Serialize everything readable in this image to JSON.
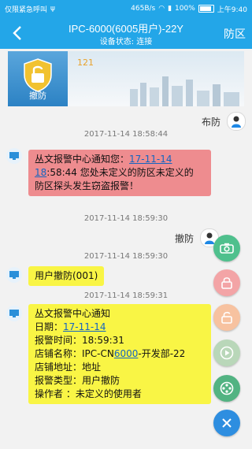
{
  "status_bar": {
    "carrier": "仅限紧急呼叫",
    "network_speed": "465B/s",
    "battery": "100%",
    "time": "上午9:40"
  },
  "header": {
    "title": "IPC-6000(6005用户)-22Y",
    "subtitle": "设备状态: 连接",
    "mode_button": "防区"
  },
  "banner": {
    "tile_label": "撤防",
    "number": "121"
  },
  "messages": {
    "m1": {
      "time": "2017-11-14 18:58:44",
      "text": "布防"
    },
    "m2": {
      "line1_prefix": "丛文报警中心通知您：",
      "link_a": "17-11-14",
      "link_b": "18",
      "line2_rest": ":58:44 您处未定义的防区未定义的",
      "line3": "防区探头发生窃盗报警！"
    },
    "m3": {
      "time": "2017-11-14 18:59:30",
      "text": "撤防"
    },
    "m4": {
      "time": "2017-11-14 18:59:30",
      "text": "用户撤防(001)"
    },
    "m5": {
      "time": "2017-11-14 18:59:31",
      "line1": "丛文报警中心通知",
      "line2_prefix": "日期：",
      "line2_link": "17-11-14",
      "line3": "报警时间：18:59:31",
      "line4_prefix": "店铺名称：IPC-CN",
      "line4_link": "6000",
      "line4_suffix": "-开发部-22",
      "line5": "店铺地址：地址",
      "line6": "报警类型：用户撤防",
      "line7": "操作者 ：未定义的使用者"
    }
  },
  "fab_icons": [
    "camera-icon",
    "lock-icon",
    "unlock-icon",
    "play-icon",
    "film-reel-icon",
    "close-icon"
  ],
  "colors": {
    "accent": "#23a6e8",
    "alarm_bubble": "#ee8c8f",
    "notice_bubble": "#f9f545"
  }
}
